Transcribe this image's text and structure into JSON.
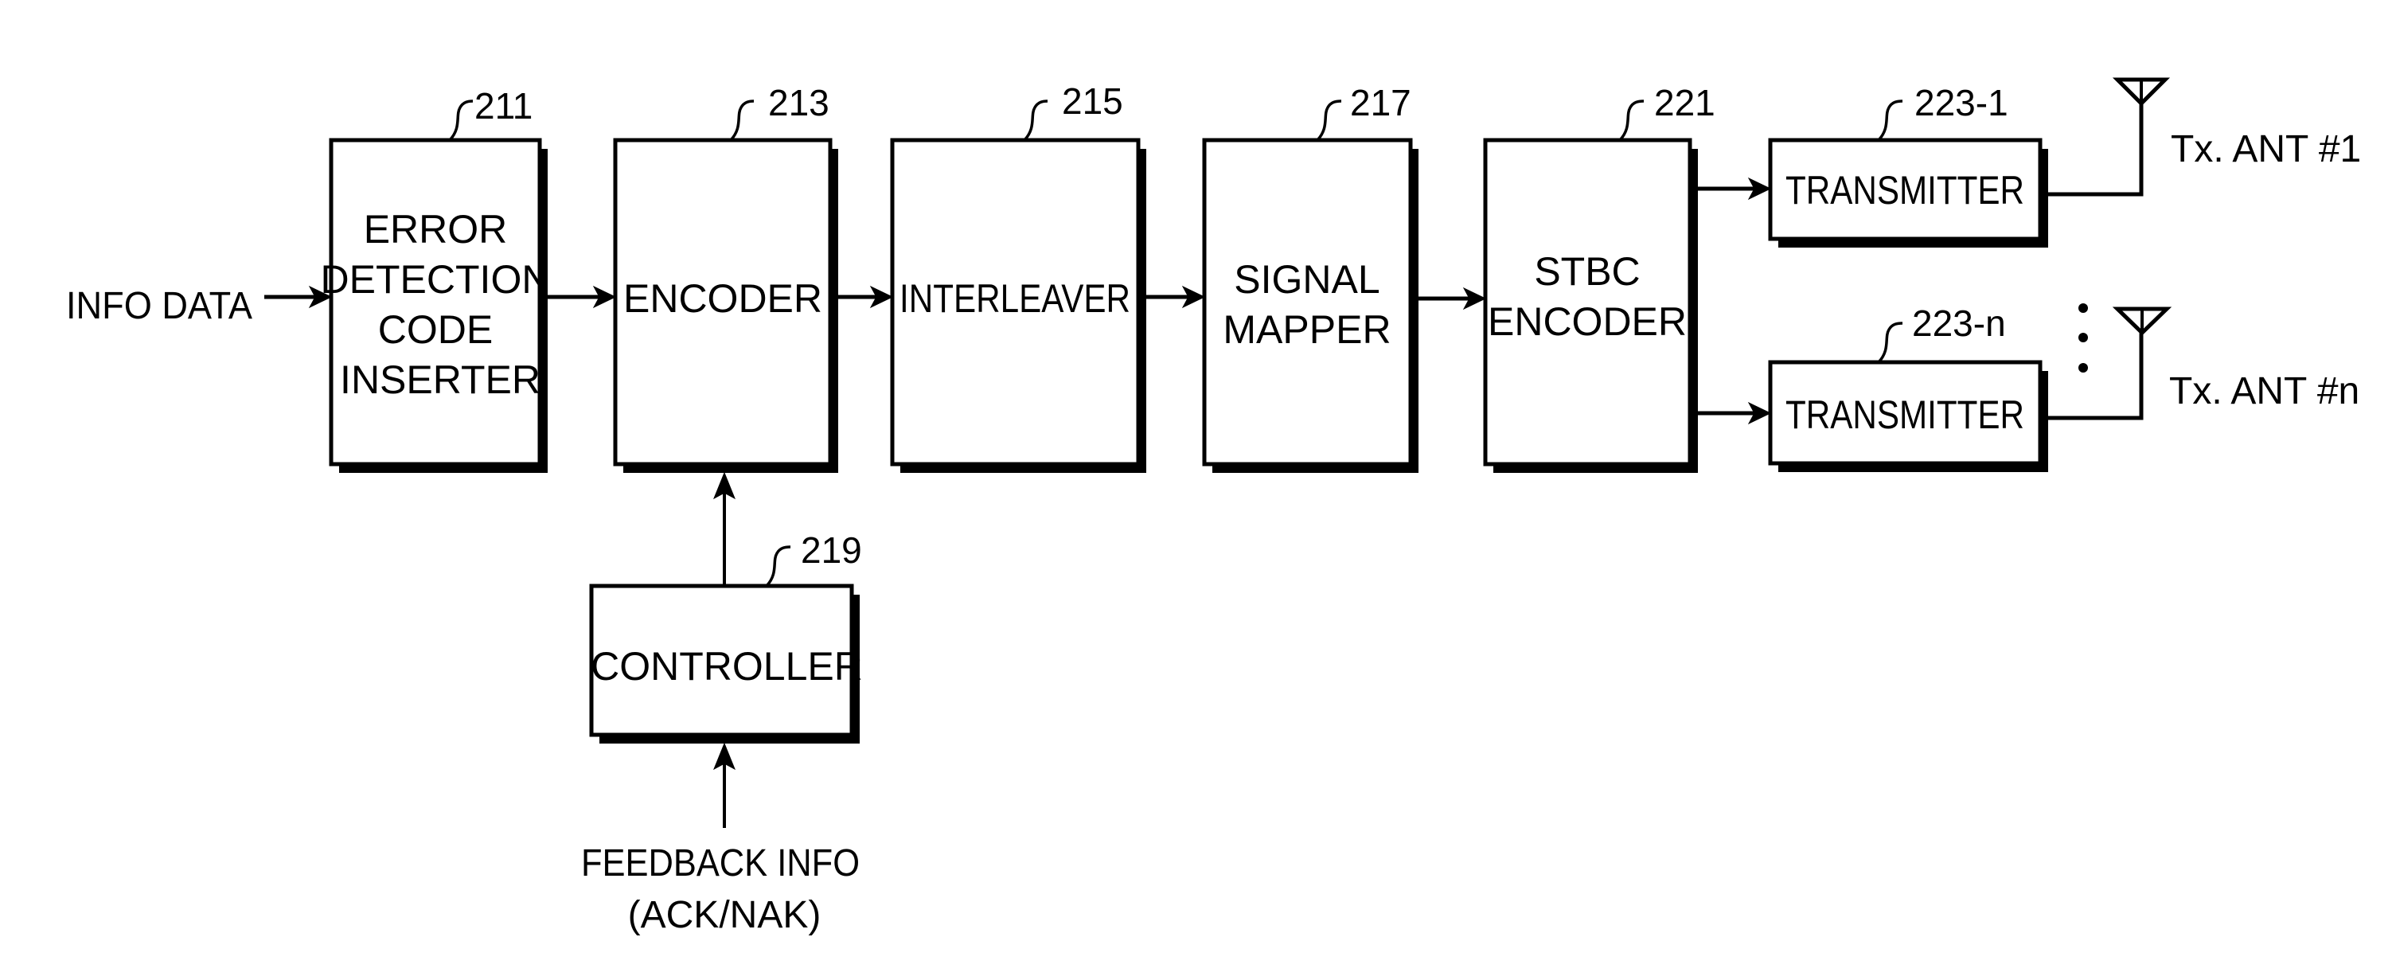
{
  "diagram": {
    "inputs": {
      "info_data": "INFO DATA",
      "feedback_line1": "FEEDBACK INFO",
      "feedback_line2": "(ACK/NAK)"
    },
    "blocks": {
      "error_detection": {
        "ref": "211",
        "lines": [
          "ERROR",
          "DETECTION",
          "CODE",
          "INSERTER"
        ]
      },
      "encoder": {
        "ref": "213",
        "lines": [
          "ENCODER"
        ]
      },
      "interleaver": {
        "ref": "215",
        "lines": [
          "INTERLEAVER"
        ]
      },
      "signal_mapper": {
        "ref": "217",
        "lines": [
          "SIGNAL",
          "MAPPER"
        ]
      },
      "controller": {
        "ref": "219",
        "lines": [
          "CONTROLLER"
        ]
      },
      "stbc_encoder": {
        "ref": "221",
        "lines": [
          "STBC",
          "ENCODER"
        ]
      },
      "transmitter_1": {
        "ref": "223-1",
        "lines": [
          "TRANSMITTER"
        ]
      },
      "transmitter_n": {
        "ref": "223-n",
        "lines": [
          "TRANSMITTER"
        ]
      }
    },
    "antennas": {
      "ant_1": "Tx. ANT #1",
      "ant_n": "Tx. ANT #n"
    },
    "connections": [
      [
        "info_data",
        "error_detection"
      ],
      [
        "error_detection",
        "encoder"
      ],
      [
        "encoder",
        "interleaver"
      ],
      [
        "interleaver",
        "signal_mapper"
      ],
      [
        "signal_mapper",
        "stbc_encoder"
      ],
      [
        "stbc_encoder",
        "transmitter_1"
      ],
      [
        "stbc_encoder",
        "transmitter_n"
      ],
      [
        "controller",
        "encoder"
      ],
      [
        "feedback_info",
        "controller"
      ],
      [
        "transmitter_1",
        "ant_1"
      ],
      [
        "transmitter_n",
        "ant_n"
      ]
    ]
  }
}
